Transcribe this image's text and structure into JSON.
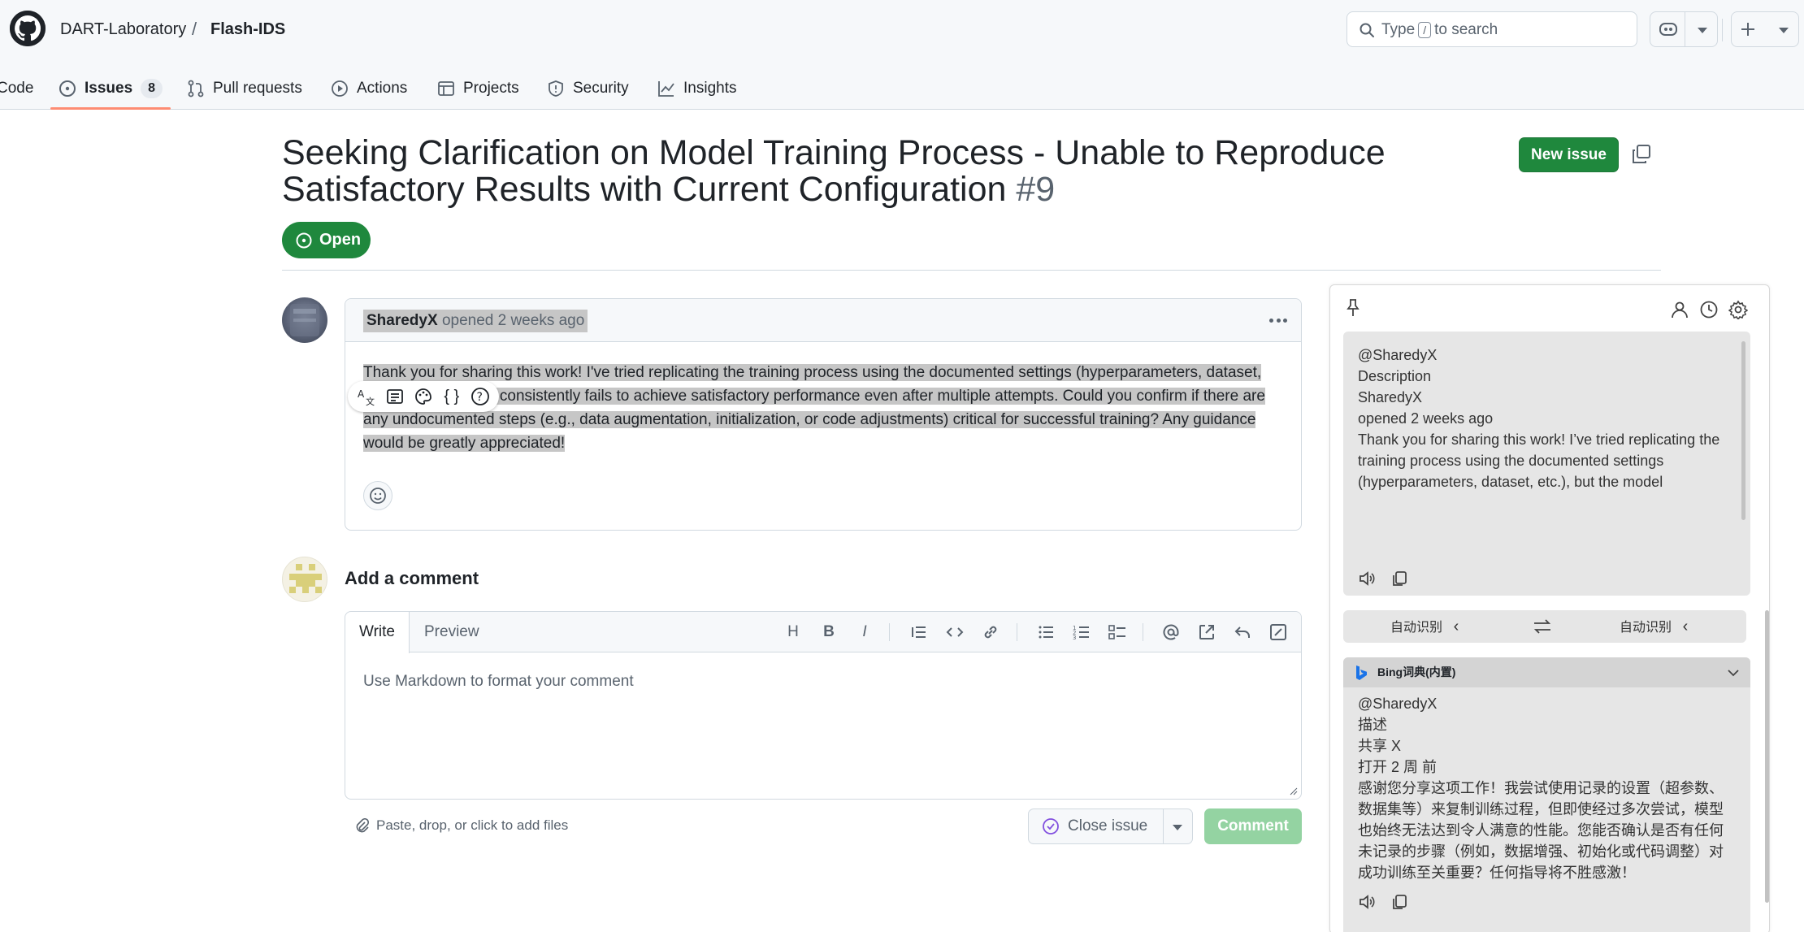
{
  "header": {
    "owner": "DART-Laboratory",
    "separator": "/",
    "repo": "Flash-IDS",
    "search_prefix": "Type",
    "search_key": "/",
    "search_suffix": "to search"
  },
  "nav": {
    "tabs": [
      {
        "label": "Code"
      },
      {
        "label": "Issues",
        "count": "8",
        "active": true
      },
      {
        "label": "Pull requests"
      },
      {
        "label": "Actions"
      },
      {
        "label": "Projects"
      },
      {
        "label": "Security"
      },
      {
        "label": "Insights"
      }
    ]
  },
  "issue": {
    "title": "Seeking Clarification on Model Training Process - Unable to Reproduce Satisfactory Results with Current Configuration",
    "number": "#9",
    "state": "Open",
    "new_issue_label": "New issue",
    "author": "SharedyX",
    "opened_text": "opened 2 weeks ago",
    "body": "Thank you for sharing this work! I've tried replicating the training process using the documented settings (hyperparameters, dataset, etc.), but the model consistently fails to achieve satisfactory performance even after multiple attempts. Could you confirm if there are any undocumented steps (e.g., data augmentation, initialization, or code adjustments) critical for successful training? Any guidance would be greatly appreciated!"
  },
  "comment_form": {
    "title": "Add a comment",
    "write_tab": "Write",
    "preview_tab": "Preview",
    "placeholder": "Use Markdown to format your comment",
    "attach_text": "Paste, drop, or click to add files",
    "close_issue_label": "Close issue",
    "comment_label": "Comment"
  },
  "translator": {
    "source_lines": [
      "@SharedyX",
      "Description",
      "SharedyX",
      "opened 2 weeks ago",
      "Thank you for sharing this work! I’ve tried replicating the training process using the documented settings (hyperparameters, dataset, etc.), but the model consistently fails to achieve satisfactory performance even after multiple attempts. Could you confirm if there are any undocumented steps (e.g., data"
    ],
    "source_lang": "自动识别",
    "target_lang": "自动识别",
    "dict_name": "Bing词典(内置)",
    "target_lines": [
      "@SharedyX",
      "描述",
      "共享 X",
      "打开 2 周 前",
      "感谢您分享这项工作！我尝试使用记录的设置（超参数、数据集等）来复制训练过程，但即使经过多次尝试，模型也始终无法达到令人满意的性能。您能否确认是否有任何未记录的步骤（例如，数据增强、初始化或代码调整）对成功训练至关重要？任何指导将不胜感激！"
    ]
  },
  "colors": {
    "primary_green": "#1f883d",
    "tab_underline": "#fd8c73",
    "disabled_green": "#94d3a2",
    "selection_gray": "#c6c6c6"
  }
}
